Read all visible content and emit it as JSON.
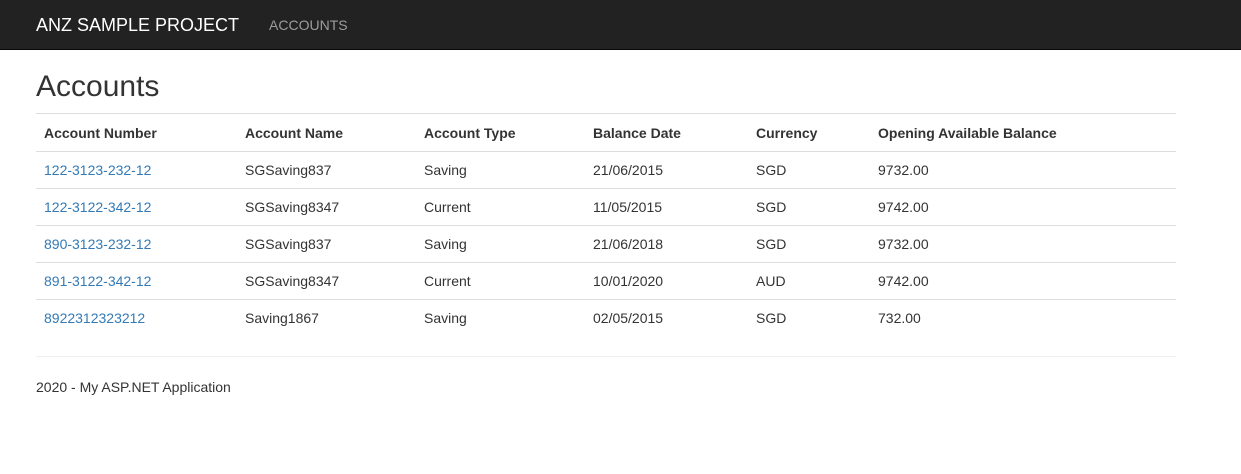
{
  "navbar": {
    "brand": "ANZ SAMPLE PROJECT",
    "links": [
      "ACCOUNTS"
    ]
  },
  "page": {
    "title": "Accounts"
  },
  "table": {
    "headers": [
      "Account Number",
      "Account Name",
      "Account Type",
      "Balance Date",
      "Currency",
      "Opening Available Balance"
    ],
    "rows": [
      [
        "122-3123-232-12",
        "SGSaving837",
        "Saving",
        "21/06/2015",
        "SGD",
        "9732.00"
      ],
      [
        "122-3122-342-12",
        "SGSaving8347",
        "Current",
        "11/05/2015",
        "SGD",
        "9742.00"
      ],
      [
        "890-3123-232-12",
        "SGSaving837",
        "Saving",
        "21/06/2018",
        "SGD",
        "9732.00"
      ],
      [
        "891-3122-342-12",
        "SGSaving8347",
        "Current",
        "10/01/2020",
        "AUD",
        "9742.00"
      ],
      [
        "8922312323212",
        "Saving1867",
        "Saving",
        "02/05/2015",
        "SGD",
        "732.00"
      ]
    ]
  },
  "footer": {
    "text": "2020 - My ASP.NET Application"
  },
  "colors": {
    "navbar_bg": "#222222",
    "link": "#337ab7",
    "nav_link": "#9d9d9d"
  }
}
